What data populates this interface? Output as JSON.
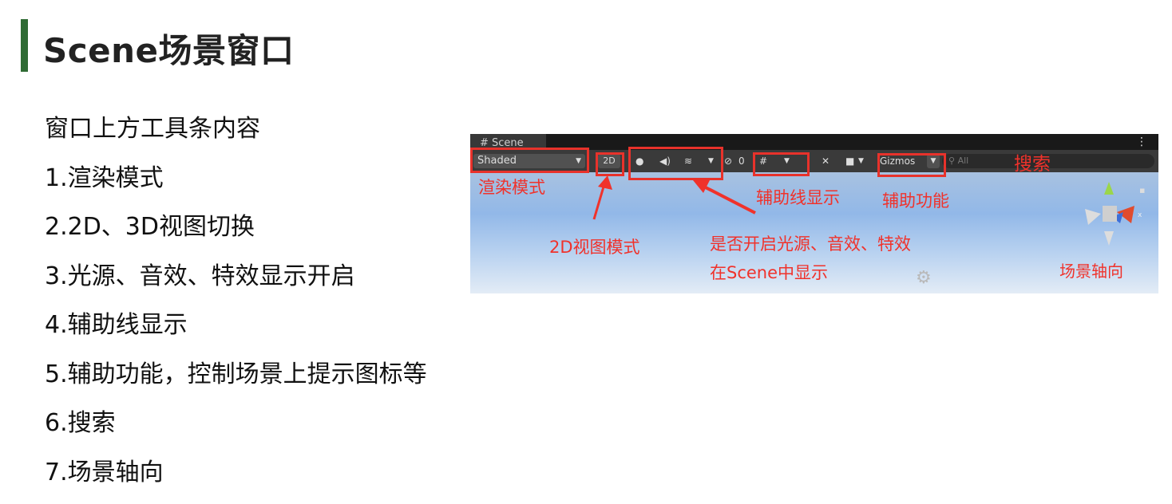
{
  "page": {
    "title": "Scene场景窗口",
    "list": [
      "窗口上方工具条内容",
      "1.渲染模式",
      "2.2D、3D视图切换",
      "3.光源、音效、特效显示开启",
      "4.辅助线显示",
      "5.辅助功能，控制场景上提示图标等",
      "6.搜索",
      "7.场景轴向"
    ]
  },
  "screenshot": {
    "tab_label": "# Scene",
    "shading_mode": "Shaded",
    "btn_2d": "2D",
    "hidden_count": "0",
    "gizmos_label": "Gizmos",
    "search_placeholder": "All",
    "annotations": {
      "render_mode": "渲染模式",
      "mode_2d": "2D视图模式",
      "toggles_line1": "是否开启光源、音效、特效",
      "toggles_line2": "在Scene中显示",
      "grid": "辅助线显示",
      "gizmos": "辅助功能",
      "search": "搜索",
      "axis": "场景轴向"
    }
  },
  "colors": {
    "accent_bar": "#2f6b34",
    "annotation": "#f0322b"
  }
}
